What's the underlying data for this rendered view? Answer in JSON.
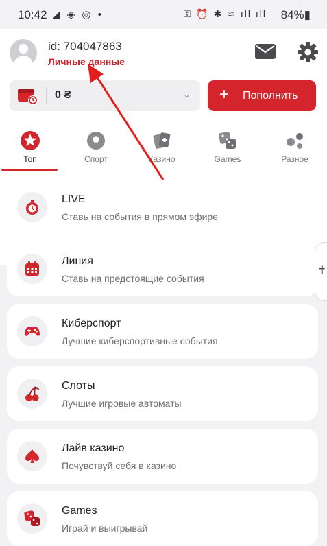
{
  "status": {
    "time": "10:42",
    "left_icons": "◢ ◈ ◎ •",
    "right_icons": "⚿ ⏰ ✱ ≋ ıll ıll",
    "battery": "84%▮"
  },
  "header": {
    "user_id": "id: 704047863",
    "personal_link": "Личные данные"
  },
  "balance": {
    "amount": "0 ₴",
    "chevron": "⌄"
  },
  "deposit": {
    "plus": "+",
    "label": "Пополнить"
  },
  "tabs": [
    {
      "label": "Топ",
      "icon": "star-badge-icon"
    },
    {
      "label": "Спорт",
      "icon": "soccer-ball-icon"
    },
    {
      "label": "Казино",
      "icon": "cards-icon"
    },
    {
      "label": "Games",
      "icon": "dice-icon"
    },
    {
      "label": "Разное",
      "icon": "dots-icon"
    }
  ],
  "cards": [
    {
      "title": "LIVE",
      "subtitle": "Ставь на события в прямом эфире",
      "icon": "stopwatch-icon"
    },
    {
      "title": "Линия",
      "subtitle": "Ставь на предстоящие события",
      "icon": "calendar-icon"
    },
    {
      "title": "Киберспорт",
      "subtitle": "Лучшие киберспортивные события",
      "icon": "gamepad-icon"
    },
    {
      "title": "Слоты",
      "subtitle": "Лучшие игровые автоматы",
      "icon": "cherries-icon"
    },
    {
      "title": "Лайв казино",
      "subtitle": "Почувствуй себя в казино",
      "icon": "spade-icon"
    },
    {
      "title": "Games",
      "subtitle": "Играй и выигрывай",
      "icon": "dice-icon"
    }
  ],
  "accessibility_glyph": "✝",
  "colors": {
    "accent": "#d4252c",
    "background": "#f2f2f4",
    "annotation_arrow": "#e11d1d"
  }
}
